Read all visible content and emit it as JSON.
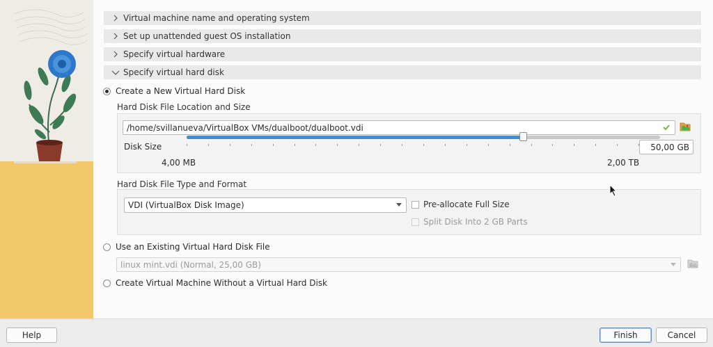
{
  "sections": [
    {
      "label": "Virtual machine name and operating system",
      "expanded": false
    },
    {
      "label": "Set up unattended guest OS installation",
      "expanded": false
    },
    {
      "label": "Specify virtual hardware",
      "expanded": false
    },
    {
      "label": "Specify virtual hard disk",
      "expanded": true
    }
  ],
  "disk_options": {
    "create_new": {
      "label": "Create a New Virtual Hard Disk",
      "selected": true
    },
    "use_existing": {
      "label": "Use an Existing Virtual Hard Disk File",
      "selected": false
    },
    "no_disk": {
      "label": "Create Virtual Machine Without a Virtual Hard Disk",
      "selected": false
    }
  },
  "location_group": {
    "title": "Hard Disk File Location and Size",
    "path_value": "/home/svillanueva/VirtualBox VMs/dualboot/dualboot.vdi",
    "size_label": "Disk Size",
    "size_value": "50,00 GB",
    "slider_fraction": 0.71,
    "min_label": "4,00 MB",
    "max_label": "2,00 TB"
  },
  "format_group": {
    "title": "Hard Disk File Type and Format",
    "format_value": "VDI (VirtualBox Disk Image)",
    "preallocate_label": "Pre-allocate Full Size",
    "split_label": "Split Disk Into 2 GB Parts"
  },
  "existing_disk": {
    "value": "linux mint.vdi (Normal, 25,00 GB)"
  },
  "footer": {
    "help": "Help",
    "finish": "Finish",
    "cancel": "Cancel"
  },
  "colors": {
    "accent": "#3d8fd1",
    "valid_check": "#6fbf3a",
    "illustration_yellow": "#f2c86a"
  },
  "icons": [
    "chevron-right-icon",
    "chevron-down-icon",
    "check-icon",
    "folder-open-icon",
    "cursor-icon"
  ]
}
